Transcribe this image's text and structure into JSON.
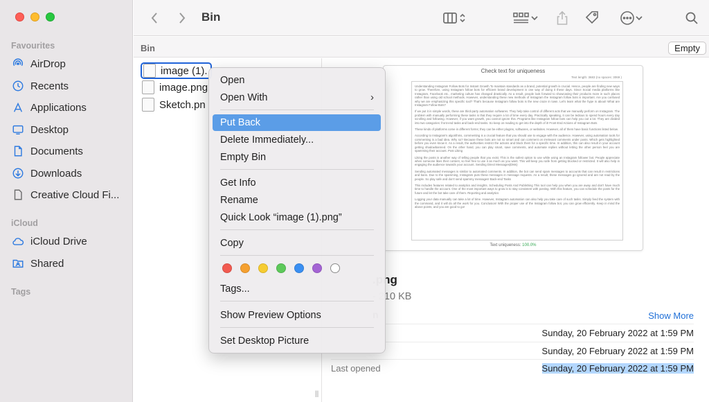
{
  "window": {
    "title": "Bin"
  },
  "sidebar": {
    "sections": [
      {
        "header": "Favourites",
        "items": [
          {
            "label": "AirDrop",
            "icon": "airdrop-icon"
          },
          {
            "label": "Recents",
            "icon": "clock-icon"
          },
          {
            "label": "Applications",
            "icon": "applications-icon"
          },
          {
            "label": "Desktop",
            "icon": "desktop-icon"
          },
          {
            "label": "Documents",
            "icon": "document-icon"
          },
          {
            "label": "Downloads",
            "icon": "download-icon"
          },
          {
            "label": "Creative Cloud Fi...",
            "icon": "file-icon"
          }
        ]
      },
      {
        "header": "iCloud",
        "items": [
          {
            "label": "iCloud Drive",
            "icon": "cloud-icon"
          },
          {
            "label": "Shared",
            "icon": "shared-folder-icon"
          }
        ]
      },
      {
        "header": "Tags",
        "items": []
      }
    ]
  },
  "pathbar": {
    "label": "Bin",
    "empty_button": "Empty"
  },
  "files": [
    {
      "name": "image (1).",
      "selected": true
    },
    {
      "name": "image.png",
      "selected": false
    },
    {
      "name": "Sketch.pn",
      "selected": false
    }
  ],
  "context_menu": {
    "items": [
      {
        "label": "Open"
      },
      {
        "label": "Open With",
        "submenu": true
      },
      {
        "label": "Put Back",
        "active": true
      },
      {
        "label": "Delete Immediately..."
      },
      {
        "label": "Empty Bin"
      },
      {
        "label": "Get Info"
      },
      {
        "label": "Rename"
      },
      {
        "label": "Quick Look “image (1).png”"
      },
      {
        "label": "Copy"
      },
      {
        "label": "Tags..."
      },
      {
        "label": "Show Preview Options"
      },
      {
        "label": "Set Desktop Picture"
      }
    ],
    "tag_colors": [
      "#f25a50",
      "#f5a030",
      "#f6cc32",
      "#5dc95a",
      "#3a8ff2",
      "#a464d4",
      "#ffffff"
    ]
  },
  "preview": {
    "doc": {
      "title": "Check text for uniqueness",
      "meta": "Text length: 3683 (no spaces: 3069 )",
      "paragraphs": [
        "Understanding Instagram Follow Bots for Instant Growth To maintain standards as a brand, potential growth is crucial. Hence, people are finding new ways to grow. Therefore, using Instagram follow bots for efficient brand development is one way of doing it these days. Since Social media platforms like Instagram, Facebook etc., marketing culture has changed drastically. As a result, people look forward to showcasing their products more in such places rather than using old school methods. However, understanding these new methods of Instagram the Instagram follow bots is important. Are you confused why we are emphasizing this specific tool? That's because Instagram follow bots is the new craze in town. Let's learn what the hype is about! What are Instagram Follow Bots?",
        "If we put it in simple words, these are third-party automation softwares. They help take control of different acts that we manually perform on Instagram. The problem with manually performing these tasks is that they require a lot of time every day. Practically speaking, it can be tedious to spend hours every day scrolling and following. However, if you want growth, you cannot ignore this. Programs like Instagram follow bots can help you out a lot. They are divided into two categories: front-end tasks and back-end tasks. So keep on reading to get into the depth of it! Front-End Actions of Instagram Bots",
        "These kinds of platforms come in different forms; they can be either plugins, softwares, or websites. However, all of them have basic functions listed below.",
        "According to Instagram's algorithms, commenting is a crucial feature that you should use to engage with the audience. However, using automation tools for commenting is a bad idea. Why so? Because these bots are not so smart and can comment on irrelevant comments under posts. Which gets highlighted before you even know it. As a result, the authorities restrict the actions and block them for a specific time. In addition, this can also result in your account getting shadowbanned. On the other hand, you can play smart, save comments, and automate replies without letting the other person feel you are spamming their account. Post Liking",
        "Liking the posts is another way of telling people that you exist. This is the safest option to use while using an Instagram follower bot. People appreciate when someone likes their content, so feel free to use it as much as you want. This will keep you safe from getting blocked or restricted. It will also help in engaging the audience towards your account. Sending Direct Messages(DMs)",
        "Sending automated messages is similar to automated comments. In addition, the bot can send spam messages to accounts that can result in restrictions and bans. Due to the spamming, Instagram puts these messages in message requests. As a result, these messages go ignored and are not read by the people. So play safe and don't send spammy messages! Back-end Tasks",
        "This includes features related to analytics and insights. Scheduling Posts And Publishing This tool can help you when you are away and don't have much time to handle the account. One of the most important ways to grow is to stay consistent with posting. With this feature, you can schedule the posts for the future and let the bot take care of them. Reporting and analytics",
        "Logging your data manually can take a lot of time. However, Instagram automation can also help you take care of such tasks. Simply feed the system with the command, and it will do all the work for you. Conclusion! With the proper use of the Instagram follow bot, you can grow efficiently. Keep in mind the above points, and you are good to go!"
      ],
      "uniqueness_label": "Text uniqueness:",
      "uniqueness_value": "100.0%"
    },
    "file_name": ".png",
    "file_size": "- 210 KB",
    "info_header": "n",
    "show_more": "Show More",
    "rows": [
      {
        "key": "",
        "value": "Sunday, 20 February 2022 at 1:59 PM",
        "highlight": false
      },
      {
        "key": "",
        "value": "Sunday, 20 February 2022 at 1:59 PM",
        "highlight": false
      },
      {
        "key": "Last opened",
        "value": "Sunday, 20 February 2022 at 1:59 PM",
        "highlight": true
      }
    ]
  },
  "colors": {
    "accent": "#1f63d9",
    "menu_highlight": "#5b9de7",
    "link": "#1f6fd7",
    "selection_highlight": "#b3d7ff"
  }
}
